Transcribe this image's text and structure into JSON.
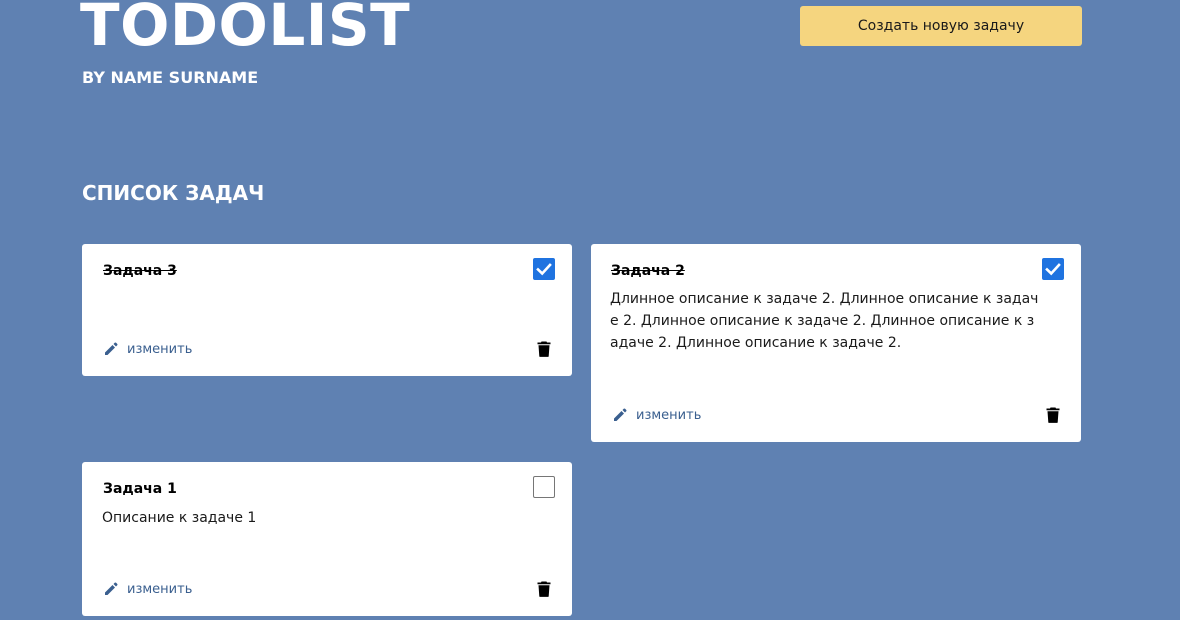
{
  "header": {
    "title": "TODOLIST",
    "byline": "BY NAME SURNAME",
    "create_button_label": "Создать новую задачу"
  },
  "section": {
    "title": "СПИСОК ЗАДАЧ"
  },
  "tasks": [
    {
      "title": "Задача 3",
      "description": "",
      "completed": true,
      "edit_label": "изменить"
    },
    {
      "title": "Задача 2",
      "description": "Длинное описание к задаче 2. Длинное описание к задаче 2. Длинное описание к задаче 2. Длинное описание к задаче 2. Длинное описание к задаче 2.",
      "completed": true,
      "edit_label": "изменить"
    },
    {
      "title": "Задача 1",
      "description": "Описание к задаче 1",
      "completed": false,
      "edit_label": "изменить"
    }
  ],
  "icons": {
    "edit": "pencil-icon",
    "delete": "trash-icon",
    "check": "checkmark-icon"
  },
  "colors": {
    "background": "#5f81b2",
    "create_button": "#f5d57f",
    "checkbox_checked": "#1f73e0",
    "edit_link": "#3a5f8f"
  }
}
